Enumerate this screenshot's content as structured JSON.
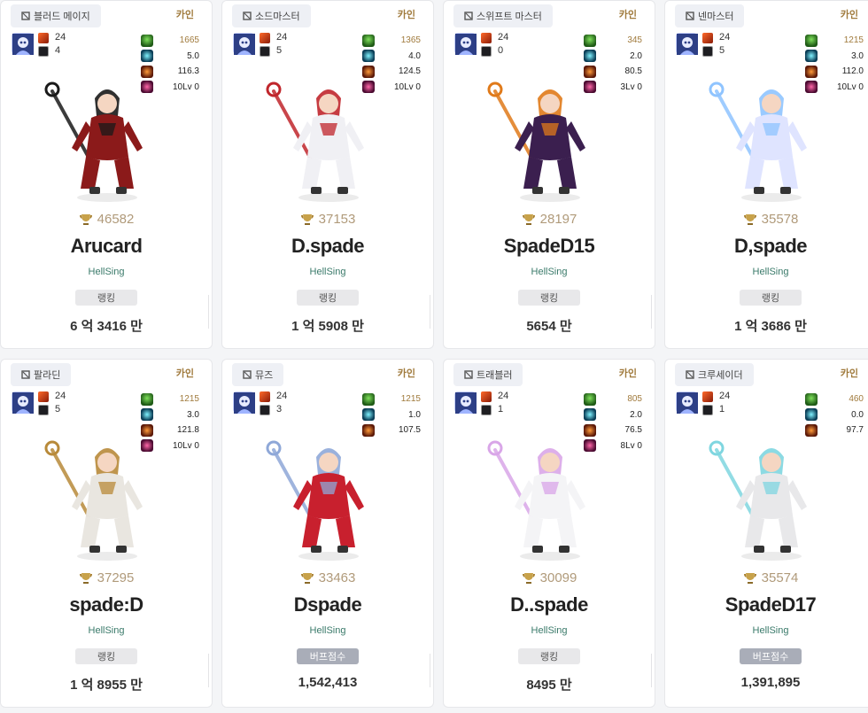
{
  "colors": {
    "server": "#a07a3c",
    "guild": "#3a7a6a",
    "score": "#b09a7a",
    "tag_rank_bg": "#e8e8ea",
    "tag_buff_bg": "#a9adb8"
  },
  "cards": [
    {
      "job": "블러드 메이지",
      "server": "카인",
      "eq_a": "24",
      "eq_b": "4",
      "stats": [
        "1665",
        "5.0",
        "116.3",
        "10Lv 0"
      ],
      "score": "46582",
      "name": "Arucard",
      "guild": "HellSing",
      "tag": "랭킹",
      "tag_type": "rank",
      "value": "6 억 3416 만",
      "char_icon": "blood-mage-character",
      "main": "#8b1a1a",
      "accent": "#1a1a1a"
    },
    {
      "job": "소드마스터",
      "server": "카인",
      "eq_a": "24",
      "eq_b": "5",
      "stats": [
        "1365",
        "4.0",
        "124.5",
        "10Lv 0"
      ],
      "score": "37153",
      "name": "D.spade",
      "guild": "HellSing",
      "tag": "랭킹",
      "tag_type": "rank",
      "value": "1 억 5908 만",
      "char_icon": "snowman-swordmaster-character",
      "main": "#f0f0f4",
      "accent": "#c0262c"
    },
    {
      "job": "스위프트 마스터",
      "server": "카인",
      "eq_a": "24",
      "eq_b": "0",
      "stats": [
        "345",
        "2.0",
        "80.5",
        "3Lv 0"
      ],
      "score": "28197",
      "name": "SpadeD15",
      "guild": "HellSing",
      "tag": "랭킹",
      "tag_type": "rank",
      "value": "5654 만",
      "char_icon": "swift-master-character",
      "main": "#3b1f4f",
      "accent": "#e07a1a"
    },
    {
      "job": "넨마스터",
      "server": "카인",
      "eq_a": "24",
      "eq_b": "5",
      "stats": [
        "1215",
        "3.0",
        "112.0",
        "10Lv 0"
      ],
      "score": "35578",
      "name": "D,spade",
      "guild": "HellSing",
      "tag": "랭킹",
      "tag_type": "rank",
      "value": "1 억 3686 만",
      "char_icon": "nen-master-character",
      "main": "#dfe4ff",
      "accent": "#8fc4ff"
    },
    {
      "job": "팔라딘",
      "server": "카인",
      "eq_a": "24",
      "eq_b": "5",
      "stats": [
        "1215",
        "3.0",
        "121.8",
        "10Lv 0"
      ],
      "score": "37295",
      "name": "spade:D",
      "guild": "HellSing",
      "tag": "랭킹",
      "tag_type": "rank",
      "value": "1 억 8955 만",
      "char_icon": "paladin-character",
      "main": "#e9e6e0",
      "accent": "#b88a3a"
    },
    {
      "job": "뮤즈",
      "server": "카인",
      "eq_a": "24",
      "eq_b": "3",
      "stats": [
        "1215",
        "1.0",
        "107.5"
      ],
      "score": "33463",
      "name": "Dspade",
      "guild": "HellSing",
      "tag": "버프점수",
      "tag_type": "buff",
      "value": "1,542,413",
      "char_icon": "muse-character",
      "main": "#c8202e",
      "accent": "#8fa8d8"
    },
    {
      "job": "트래블러",
      "server": "카인",
      "eq_a": "24",
      "eq_b": "1",
      "stats": [
        "805",
        "2.0",
        "76.5",
        "8Lv 0"
      ],
      "score": "30099",
      "name": "D..spade",
      "guild": "HellSing",
      "tag": "랭킹",
      "tag_type": "rank",
      "value": "8495 만",
      "char_icon": "traveler-character",
      "main": "#f4f4f6",
      "accent": "#d9a6e8"
    },
    {
      "job": "크루세이더",
      "server": "카인",
      "eq_a": "24",
      "eq_b": "1",
      "stats": [
        "460",
        "0.0",
        "97.7"
      ],
      "score": "35574",
      "name": "SpadeD17",
      "guild": "HellSing",
      "tag": "버프점수",
      "tag_type": "buff",
      "value": "1,391,895",
      "char_icon": "crusader-character",
      "main": "#e8e8ea",
      "accent": "#7fd6e0"
    }
  ]
}
